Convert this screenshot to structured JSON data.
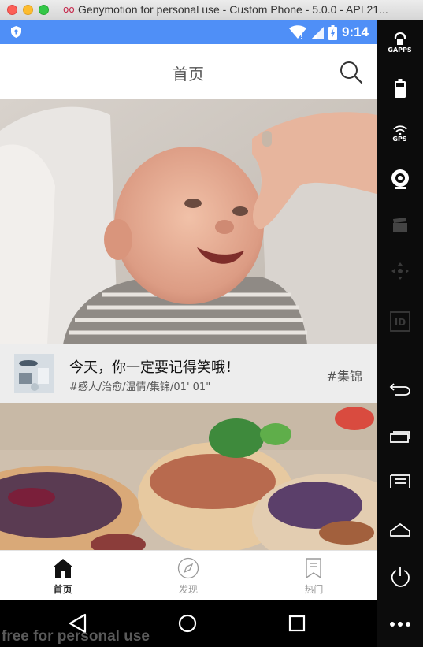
{
  "window": {
    "title": "Genymotion for personal use - Custom Phone - 5.0.0 - API 21...",
    "title_icon": "oo"
  },
  "status_bar": {
    "time": "9:14",
    "icons": [
      "shield-icon",
      "wifi-icon",
      "signal-icon",
      "battery-charging-icon"
    ]
  },
  "app_bar": {
    "title": "首页",
    "search_icon": "search-icon"
  },
  "feed": [
    {
      "image": "smiling-baby-photo",
      "thumbnail": "fish-still-life-thumbnail",
      "title": "今天，你一定要记得笑哦！",
      "subtitle": "#感人/治愈/温情/集锦/01' 01\"",
      "tag": "#集锦"
    },
    {
      "image": "food-bowls-photo"
    }
  ],
  "tab_bar": {
    "tabs": [
      {
        "label": "首页",
        "icon": "home-icon",
        "active": true
      },
      {
        "label": "发现",
        "icon": "compass-icon",
        "active": false
      },
      {
        "label": "热门",
        "icon": "bookmark-icon",
        "active": false
      }
    ]
  },
  "nav_bar": {
    "buttons": [
      "back-icon",
      "home-circle-icon",
      "recents-icon"
    ],
    "watermark": "free for personal use"
  },
  "sidebar": {
    "buttons": [
      {
        "icon": "gapps-icon",
        "label": "GAPPS"
      },
      {
        "icon": "battery-icon",
        "label": ""
      },
      {
        "icon": "gps-icon",
        "label": "GPS"
      },
      {
        "icon": "webcam-icon",
        "label": ""
      },
      {
        "icon": "clapperboard-icon",
        "label": ""
      },
      {
        "icon": "dpad-icon",
        "label": ""
      },
      {
        "icon": "id-icon",
        "label": "ID"
      },
      {
        "icon": "back-arrow-icon",
        "label": ""
      },
      {
        "icon": "recent-apps-icon",
        "label": ""
      },
      {
        "icon": "menu-icon",
        "label": ""
      },
      {
        "icon": "home-icon",
        "label": ""
      },
      {
        "icon": "power-icon",
        "label": ""
      },
      {
        "icon": "more-icon",
        "label": ""
      }
    ]
  },
  "colors": {
    "status_bar": "#4f8ff7",
    "meta_background": "#ededed",
    "tab_active": "#222222",
    "tab_inactive": "#9a9a9a"
  }
}
